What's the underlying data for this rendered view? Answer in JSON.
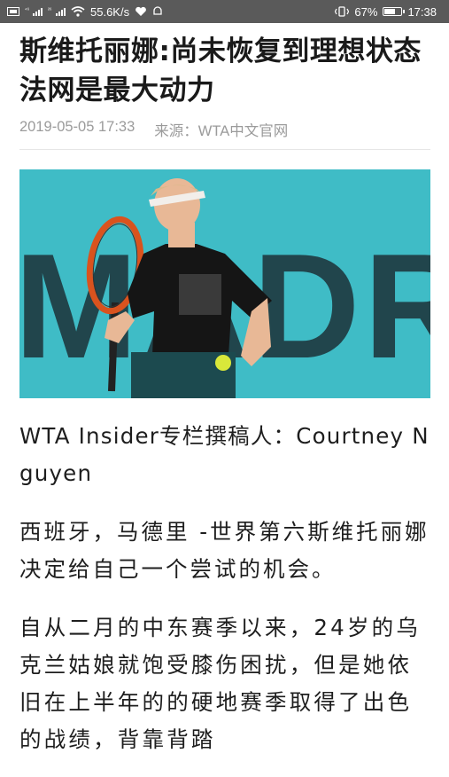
{
  "status_bar": {
    "network_speed": "55.6K/s",
    "signal_1": "⁴⁶",
    "signal_2": "²⁶",
    "battery_percent": "67%",
    "battery_level": 0.67,
    "time": "17:38"
  },
  "article": {
    "title": "斯维托丽娜:尚未恢复到理想状态 法网是最大动力",
    "date": "2019-05-05 17:33",
    "source": "来源：WTA中文官网",
    "image": {
      "bg_text": "MADR"
    },
    "author_line": "WTA Insider专栏撰稿人：Courtney Nguyen",
    "paragraphs": [
      "西班牙，马德里 -世界第六斯维托丽娜决定给自己一个尝试的机会。",
      "自从二月的中东赛季以来，24岁的乌克兰姑娘就饱受膝伤困扰，但是她依旧在上半年的的硬地赛季取得了出色的战绩，背靠背踏"
    ]
  },
  "colors": {
    "status_bar_bg": "#5a5a5a",
    "photo_bg": "#3fbcc6",
    "meta_text": "#9b9b9b"
  }
}
